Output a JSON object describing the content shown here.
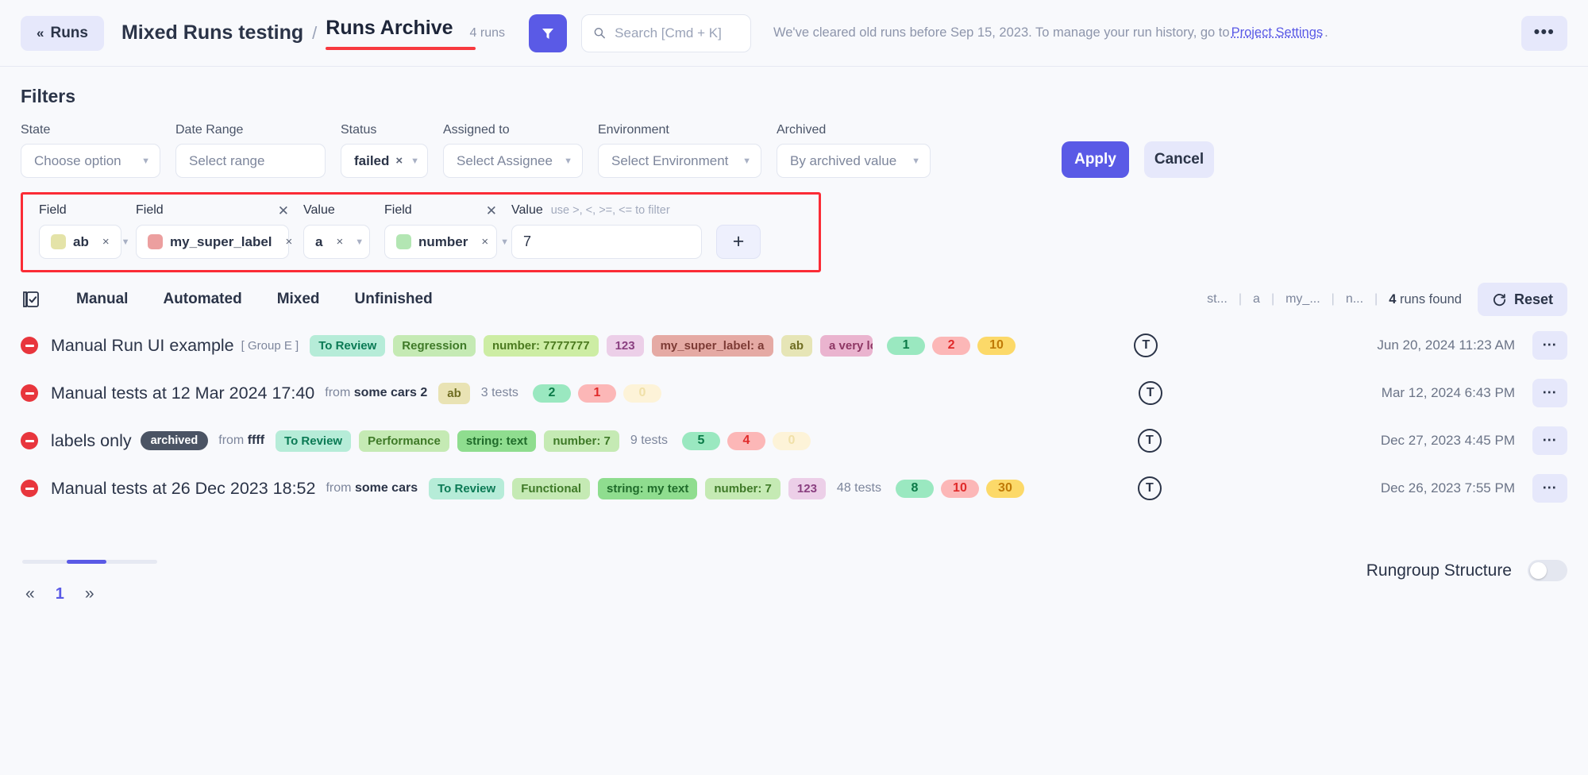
{
  "header": {
    "back_label": "Runs",
    "back_icon": "double-chevron-left-icon",
    "project": "Mixed Runs testing",
    "separator": "/",
    "current": "Runs Archive",
    "count": "4 runs",
    "filter_icon": "funnel-icon",
    "search_placeholder": "Search [Cmd + K]",
    "search_value": "",
    "search_icon": "search-icon",
    "notice_before": "We've cleared old runs before Sep 15, 2023. To manage your run history, go to ",
    "notice_link": "Project Settings",
    "notice_after": ".",
    "more_label": "•••"
  },
  "filters": {
    "title": "Filters",
    "fields": [
      {
        "label": "State",
        "value": "Choose option",
        "has_clear": false
      },
      {
        "label": "Date Range",
        "value": "Select range",
        "has_clear": false
      },
      {
        "label": "Status",
        "value": "failed",
        "has_clear": true
      },
      {
        "label": "Assigned to",
        "value": "Select Assignee",
        "has_clear": false
      },
      {
        "label": "Environment",
        "value": "Select Environment",
        "has_clear": false
      },
      {
        "label": "Archived",
        "value": "By archived value",
        "has_clear": false
      }
    ],
    "apply_label": "Apply",
    "cancel_label": "Cancel",
    "caret_icon": "chevron-down-icon",
    "clear_icon": "close-small-icon"
  },
  "custom_filters": {
    "highlight_color": "#fb2c36",
    "items": [
      {
        "label": "Field",
        "hint": "",
        "value": "ab",
        "swatch": "#e4e3a8",
        "kind": "select",
        "has_x": false
      },
      {
        "label": "Field",
        "hint": "",
        "value": "my_super_label",
        "swatch": "#ec9f9f",
        "kind": "select",
        "has_x": true
      },
      {
        "label": "Value",
        "hint": "",
        "value": "a",
        "swatch": "",
        "kind": "select",
        "has_x": false
      },
      {
        "label": "Field",
        "hint": "",
        "value": "number",
        "swatch": "#b3e6b3",
        "kind": "select",
        "has_x": true
      },
      {
        "label": "Value",
        "hint": "use >, <, >=, <= to filter",
        "value": "7",
        "swatch": "",
        "kind": "input",
        "has_x": false
      }
    ],
    "add_label": "+",
    "remove_icon": "close-icon"
  },
  "tabs": {
    "list_icon": "checklist-icon",
    "items": [
      "Manual",
      "Automated",
      "Mixed",
      "Unfinished"
    ],
    "mini_chips": [
      "st...",
      "a",
      "my_...",
      "n..."
    ],
    "mini_divider": "|",
    "runs_found_count": "4",
    "runs_found_label": "runs found",
    "reset_label": "Reset",
    "reset_icon": "refresh-icon"
  },
  "runs": [
    {
      "title": "Manual Run UI example",
      "group": "[ Group E ]",
      "archived": "",
      "from": "",
      "labels": [
        {
          "text": "To Review",
          "bg": "#b6ecd8",
          "fg": "#0b7a55",
          "clip": false
        },
        {
          "text": "Regression",
          "bg": "#c5eab4",
          "fg": "#3f7a28",
          "clip": false
        },
        {
          "text": "number: 7777777",
          "bg": "#cdeda4",
          "fg": "#4b7a1f",
          "clip": false
        },
        {
          "text": "123",
          "bg": "#eccfe8",
          "fg": "#8a3f80",
          "clip": false
        },
        {
          "text": "my_super_label: a",
          "bg": "#e5aaa4",
          "fg": "#7d3b35",
          "clip": false
        },
        {
          "text": "ab",
          "bg": "#e6e5b6",
          "fg": "#6f6d22",
          "clip": false
        },
        {
          "text": "a very loooong",
          "bg": "#eab4cf",
          "fg": "#8e3764",
          "clip": true
        }
      ],
      "tests": "",
      "counts": [
        "1",
        "2",
        "10"
      ],
      "counts_zero": [
        false,
        false,
        false
      ],
      "avatar": "T",
      "date": "Jun 20, 2024 11:23 AM"
    },
    {
      "title": "Manual tests at 12 Mar 2024 17:40",
      "group": "",
      "archived": "",
      "from": "some cars 2",
      "labels": [
        {
          "text": "ab",
          "bg": "#e9e3b4",
          "fg": "#6f6d22",
          "clip": false
        }
      ],
      "tests": "3 tests",
      "counts": [
        "2",
        "1",
        "0"
      ],
      "counts_zero": [
        false,
        false,
        true
      ],
      "avatar": "T",
      "date": "Mar 12, 2024 6:43 PM"
    },
    {
      "title": "labels only",
      "group": "",
      "archived": "archived",
      "from": "ffff",
      "labels": [
        {
          "text": "To Review",
          "bg": "#b6ecd8",
          "fg": "#0b7a55",
          "clip": false
        },
        {
          "text": "Performance",
          "bg": "#c5eab4",
          "fg": "#3f7a28",
          "clip": false
        },
        {
          "text": "string: text",
          "bg": "#8fdd8f",
          "fg": "#1f6b2a",
          "clip": false
        },
        {
          "text": "number: 7",
          "bg": "#c5eab4",
          "fg": "#3f7a28",
          "clip": false
        }
      ],
      "tests": "9 tests",
      "counts": [
        "5",
        "4",
        "0"
      ],
      "counts_zero": [
        false,
        false,
        true
      ],
      "avatar": "T",
      "date": "Dec 27, 2023 4:45 PM"
    },
    {
      "title": "Manual tests at 26 Dec 2023 18:52",
      "group": "",
      "archived": "",
      "from": "some cars",
      "labels": [
        {
          "text": "To Review",
          "bg": "#b6ecd8",
          "fg": "#0b7a55",
          "clip": false
        },
        {
          "text": "Functional",
          "bg": "#c5eab4",
          "fg": "#3f7a28",
          "clip": false
        },
        {
          "text": "string: my text",
          "bg": "#8fdd8f",
          "fg": "#1f6b2a",
          "clip": false
        },
        {
          "text": "number: 7",
          "bg": "#c5eab4",
          "fg": "#3f7a28",
          "clip": false
        },
        {
          "text": "123",
          "bg": "#eccfe8",
          "fg": "#8a3f80",
          "clip": false
        }
      ],
      "tests": "48 tests",
      "counts": [
        "8",
        "10",
        "30"
      ],
      "counts_zero": [
        false,
        false,
        false
      ],
      "avatar": "T",
      "date": "Dec 26, 2023 7:55 PM"
    }
  ],
  "footer": {
    "prev_label": "«",
    "page": "1",
    "next_label": "»",
    "rungroup_label": "Rungroup Structure",
    "rungroup_on": false
  }
}
